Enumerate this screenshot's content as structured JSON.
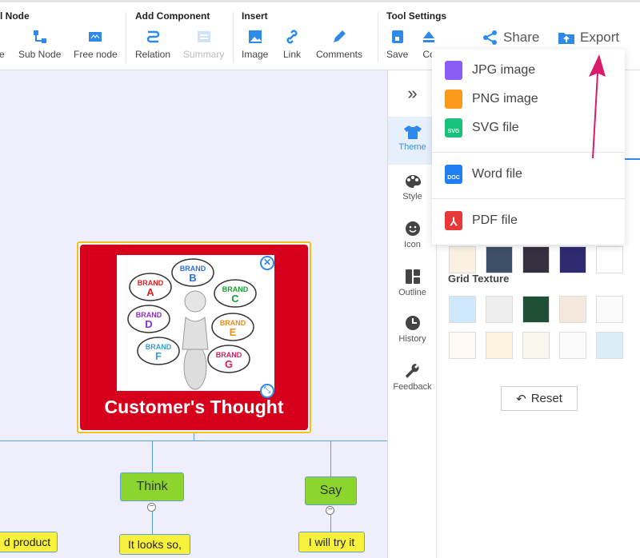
{
  "toolbar": {
    "groups": [
      {
        "title": "l Node",
        "tools": [
          {
            "label": "le"
          },
          {
            "label": "Sub Node"
          },
          {
            "label": "Free node"
          }
        ]
      },
      {
        "title": "Add Component",
        "tools": [
          {
            "label": "Relation"
          },
          {
            "label": "Summary",
            "disabled": true
          }
        ]
      },
      {
        "title": "Insert",
        "tools": [
          {
            "label": "Image"
          },
          {
            "label": "Link"
          },
          {
            "label": "Comments"
          }
        ]
      },
      {
        "title": "Tool Settings",
        "tools": [
          {
            "label": "Save"
          },
          {
            "label": "Co"
          }
        ]
      }
    ],
    "share": "Share",
    "export": "Export",
    "accent": "#2d8ae8"
  },
  "export_menu": {
    "items": [
      {
        "label": "JPG image",
        "icon": "jpg-file-icon",
        "color": "#8b5cf6",
        "tag": ""
      },
      {
        "label": "PNG image",
        "icon": "png-file-icon",
        "color": "#fb9a1a",
        "tag": ""
      },
      {
        "label": "SVG file",
        "icon": "svg-file-icon",
        "color": "#17c27a",
        "tag": "SVG"
      },
      {
        "label": "Word file",
        "icon": "word-file-icon",
        "color": "#1f7ef0",
        "tag": "DOC"
      },
      {
        "label": "PDF file",
        "icon": "pdf-file-icon",
        "color": "#e83838",
        "tag": ""
      }
    ]
  },
  "arrow_color": "#d81b6a",
  "panel": {
    "tabs": [
      {
        "label": "Theme",
        "active": true
      },
      {
        "label": "Style"
      },
      {
        "label": "Icon"
      },
      {
        "label": "Outline"
      },
      {
        "label": "History"
      },
      {
        "label": "Feedback"
      }
    ],
    "grid_texture_title": "Grid Texture",
    "reset": "Reset"
  },
  "map": {
    "root": {
      "title": "Customer's Thought",
      "image_text": [
        "BRAND A",
        "BRAND B",
        "BRAND C",
        "BRAND D",
        "BRAND E",
        "BRAND F",
        "BRAND G"
      ]
    },
    "branches": [
      {
        "label": "Think",
        "child": "It looks so,"
      },
      {
        "label": "Say",
        "child": "I will try it"
      }
    ],
    "partial_leaf": "d product"
  }
}
